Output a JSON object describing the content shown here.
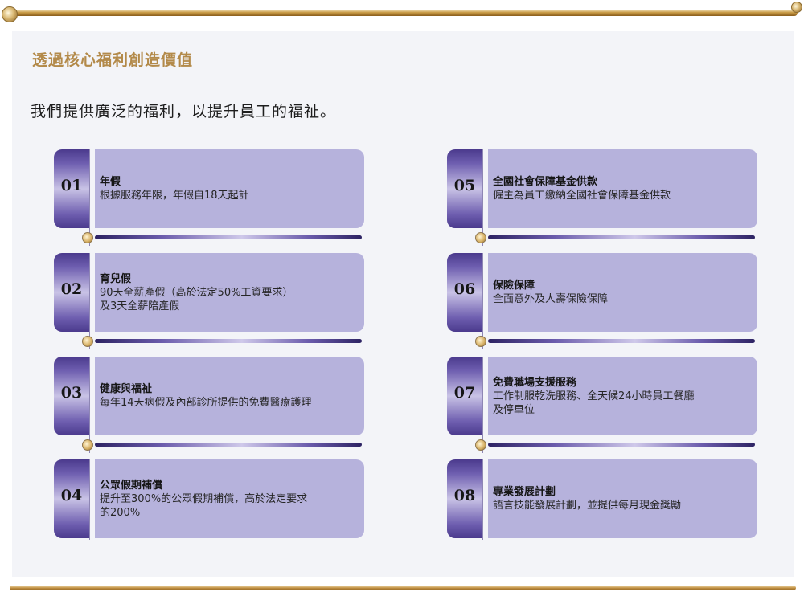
{
  "heading": "透過核心福利創造價值",
  "subtitle": "我們提供廣泛的福利，以提升員工的福祉。",
  "colors": {
    "gold": "#b38a4a",
    "card_body": "#b6b2dc",
    "tab_dark": "#4b3a8d",
    "panel": "#f3f4f8"
  },
  "benefits": [
    {
      "num": "01",
      "title": "年假",
      "desc": "根據服務年限，年假自18天起計"
    },
    {
      "num": "02",
      "title": "育兒假",
      "desc": "90天全薪產假（高於法定50%工資要求）\n及3天全薪陪產假"
    },
    {
      "num": "03",
      "title": "健康與福祉",
      "desc": "每年14天病假及內部診所提供的免費醫療護理"
    },
    {
      "num": "04",
      "title": "公眾假期補償",
      "desc": "提升至300%的公眾假期補償，高於法定要求\n的200%"
    },
    {
      "num": "05",
      "title": "全國社會保障基金供款",
      "desc": "僱主為員工繳納全國社會保障基金供款"
    },
    {
      "num": "06",
      "title": "保險保障",
      "desc": "全面意外及人壽保險保障"
    },
    {
      "num": "07",
      "title": "免費職場支援服務",
      "desc": "工作制服乾洗服務、全天候24小時員工餐廳\n及停車位"
    },
    {
      "num": "08",
      "title": "專業發展計劃",
      "desc": "語言技能發展計劃，並提供每月現金獎勵"
    }
  ]
}
